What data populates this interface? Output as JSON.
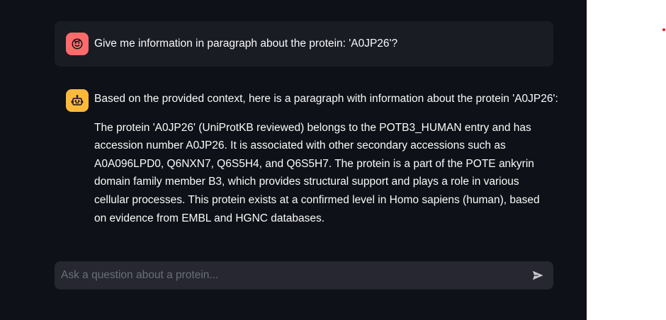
{
  "chat": {
    "messages": [
      {
        "role": "user",
        "avatar_icon": "smiley-face-icon",
        "text": "Give me information in paragraph about the protein: 'A0JP26'?"
      },
      {
        "role": "assistant",
        "avatar_icon": "robot-icon",
        "intro": "Based on the provided context, here is a paragraph with information about the protein 'A0JP26':",
        "paragraph": "The protein 'A0JP26' (UniProtKB reviewed) belongs to the POTB3_HUMAN entry and has accession number A0JP26. It is associated with other secondary accessions such as A0A096LPD0, Q6NXN7, Q6S5H4, and Q6S5H7. The protein is a part of the POTE ankyrin domain family member B3, which provides structural support and plays a role in various cellular processes. This protein exists at a confirmed level in Homo sapiens (human), based on evidence from EMBL and HGNC databases."
      }
    ]
  },
  "input": {
    "placeholder": "Ask a question about a protein...",
    "value": "",
    "send_icon": "send-arrow-icon"
  },
  "colors": {
    "background": "#0e1117",
    "user_message_bg": "#1a1c24",
    "input_bg": "#262730",
    "user_avatar": "#ff6b6b",
    "assistant_avatar": "#fdb93c",
    "text": "#fafafa",
    "right_pane": "#ffffff",
    "dot": "#e0242a"
  }
}
